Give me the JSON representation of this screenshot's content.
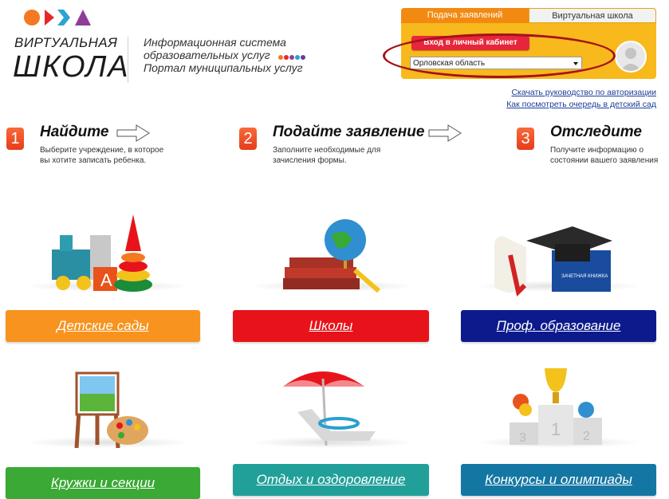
{
  "logo": {
    "line1": "ВИРТУАЛЬНАЯ",
    "line2": "ШКОЛА",
    "shape_colors": [
      "#f47920",
      "#e4292b",
      "#2aa4d0",
      "#8e3e97"
    ]
  },
  "header": {
    "tagline1": "Информационная система",
    "tagline2": "образовательных услуг",
    "tagline3": "Портал муниципальных услуг",
    "dot_colors": [
      "#f47920",
      "#e4292b",
      "#8e3e97",
      "#2aa4d0",
      "#6a3c96"
    ]
  },
  "login_panel": {
    "tab_active": "Подача заявлений",
    "tab_inactive": "Виртуальная школа",
    "login_button": "Вход в личный кабинет",
    "region_selected": "Орловская область",
    "avatar_icon": "user-icon"
  },
  "links": {
    "manual": "Скачать руководство по авторизации",
    "queue": "Как посмотреть очередь в детский сад"
  },
  "steps": [
    {
      "number": "1",
      "title": "Найдите",
      "text1": "Выберите учреждение, в которое",
      "text2": "вы хотите записать ребенка."
    },
    {
      "number": "2",
      "title": "Подайте заявление",
      "text1": "Заполните необходимые для",
      "text2": "зачисления формы."
    },
    {
      "number": "3",
      "title": "Отследите",
      "text1": "Получите информацию о",
      "text2": "состоянии вашего заявления"
    }
  ],
  "categories": [
    {
      "label": "Детские сады",
      "color": "#f7931e",
      "icon": "toys-icon"
    },
    {
      "label": "Школы",
      "color": "#e8131a",
      "icon": "books-globe-icon"
    },
    {
      "label": "Проф. образование",
      "color": "#0d1a8c",
      "icon": "graduation-cap-icon"
    },
    {
      "label": "Кружки и секции",
      "color": "#3aa935",
      "icon": "easel-palette-icon"
    },
    {
      "label": "Отдых и оздоровление",
      "color": "#21a09a",
      "icon": "beach-chair-icon"
    },
    {
      "label": "Конкурсы и олимпиады",
      "color": "#1477a3",
      "icon": "trophy-podium-icon"
    }
  ]
}
